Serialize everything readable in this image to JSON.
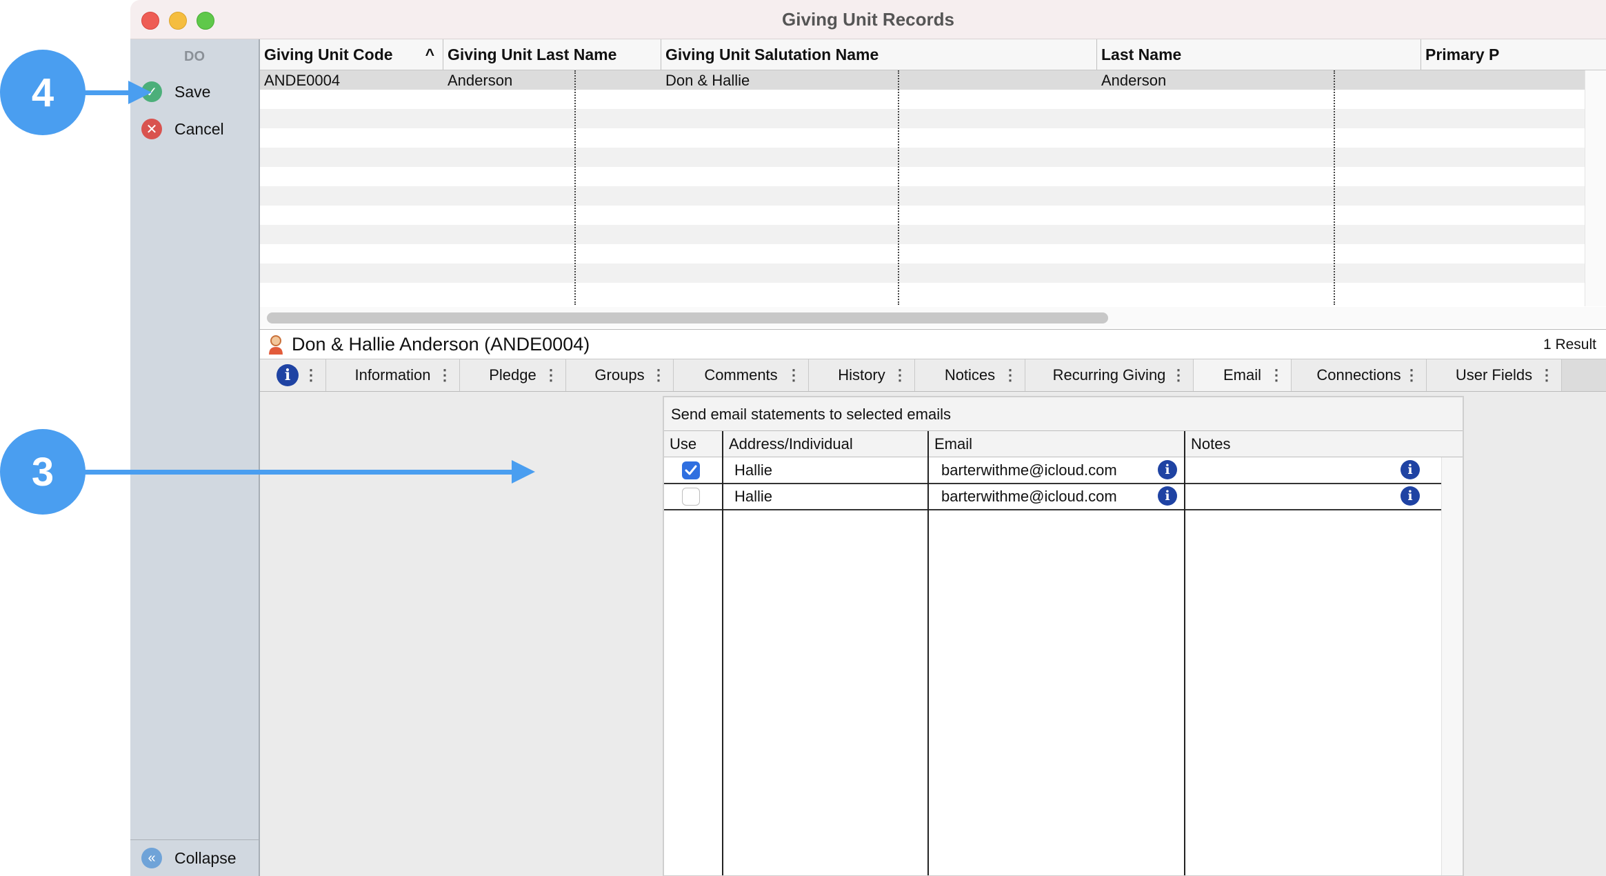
{
  "window": {
    "title": "Giving Unit Records"
  },
  "sidebar": {
    "section_label": "DO",
    "save_label": "Save",
    "cancel_label": "Cancel",
    "collapse_label": "Collapse"
  },
  "grid": {
    "columns": [
      "Giving Unit Code",
      "Giving Unit Last Name",
      "Giving Unit Salutation Name",
      "Last Name",
      "Primary P"
    ],
    "sort_indicator": "^",
    "rows": [
      [
        "ANDE0004",
        "Anderson",
        "Don & Hallie",
        "Anderson",
        ""
      ]
    ]
  },
  "record": {
    "name": "Don & Hallie Anderson (ANDE0004)",
    "result_count": "1 Result"
  },
  "tabs": {
    "items": [
      "Information",
      "Pledge",
      "Groups",
      "Comments",
      "History",
      "Notices",
      "Recurring Giving",
      "Email",
      "Connections",
      "User Fields"
    ],
    "active": "Email",
    "more_glyph": "⋮"
  },
  "email_panel": {
    "title": "Send email statements to selected emails",
    "columns": {
      "use": "Use",
      "address": "Address/Individual",
      "email": "Email",
      "notes": "Notes"
    },
    "rows": [
      {
        "use": true,
        "individual": "Hallie",
        "email": "barterwithme@icloud.com",
        "notes": ""
      },
      {
        "use": false,
        "individual": "Hallie",
        "email": "barterwithme@icloud.com",
        "notes": ""
      }
    ]
  },
  "annotations": {
    "step_save": "4",
    "step_checkbox": "3"
  },
  "colors": {
    "accent": "#4a9ef0",
    "save": "#4caf7a",
    "cancel": "#d9534f",
    "info": "#1f43a3"
  }
}
